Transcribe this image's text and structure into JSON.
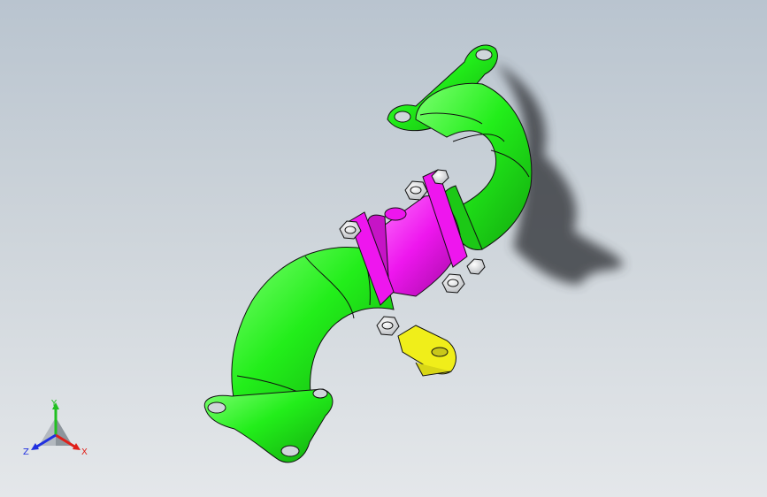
{
  "viewport": {
    "background_top": "#b9c4cf",
    "background_bottom": "#e4e7ea"
  },
  "model": {
    "parts": [
      {
        "name": "elbow-pipe-upper",
        "color": "#22ee1a"
      },
      {
        "name": "elbow-pipe-lower",
        "color": "#22ee1a"
      },
      {
        "name": "coupling-sleeve",
        "color": "#ee16ee"
      },
      {
        "name": "support-bracket",
        "color": "#f0ee1a"
      },
      {
        "name": "bolt-nut",
        "color": "#eeeeee"
      }
    ],
    "edge_color": "#111111",
    "shadow_color": "#3c3f44"
  },
  "triad": {
    "x_label": "X",
    "y_label": "Y",
    "z_label": "Z",
    "x_color": "#e0201a",
    "y_color": "#20c020",
    "z_color": "#2030e0"
  }
}
